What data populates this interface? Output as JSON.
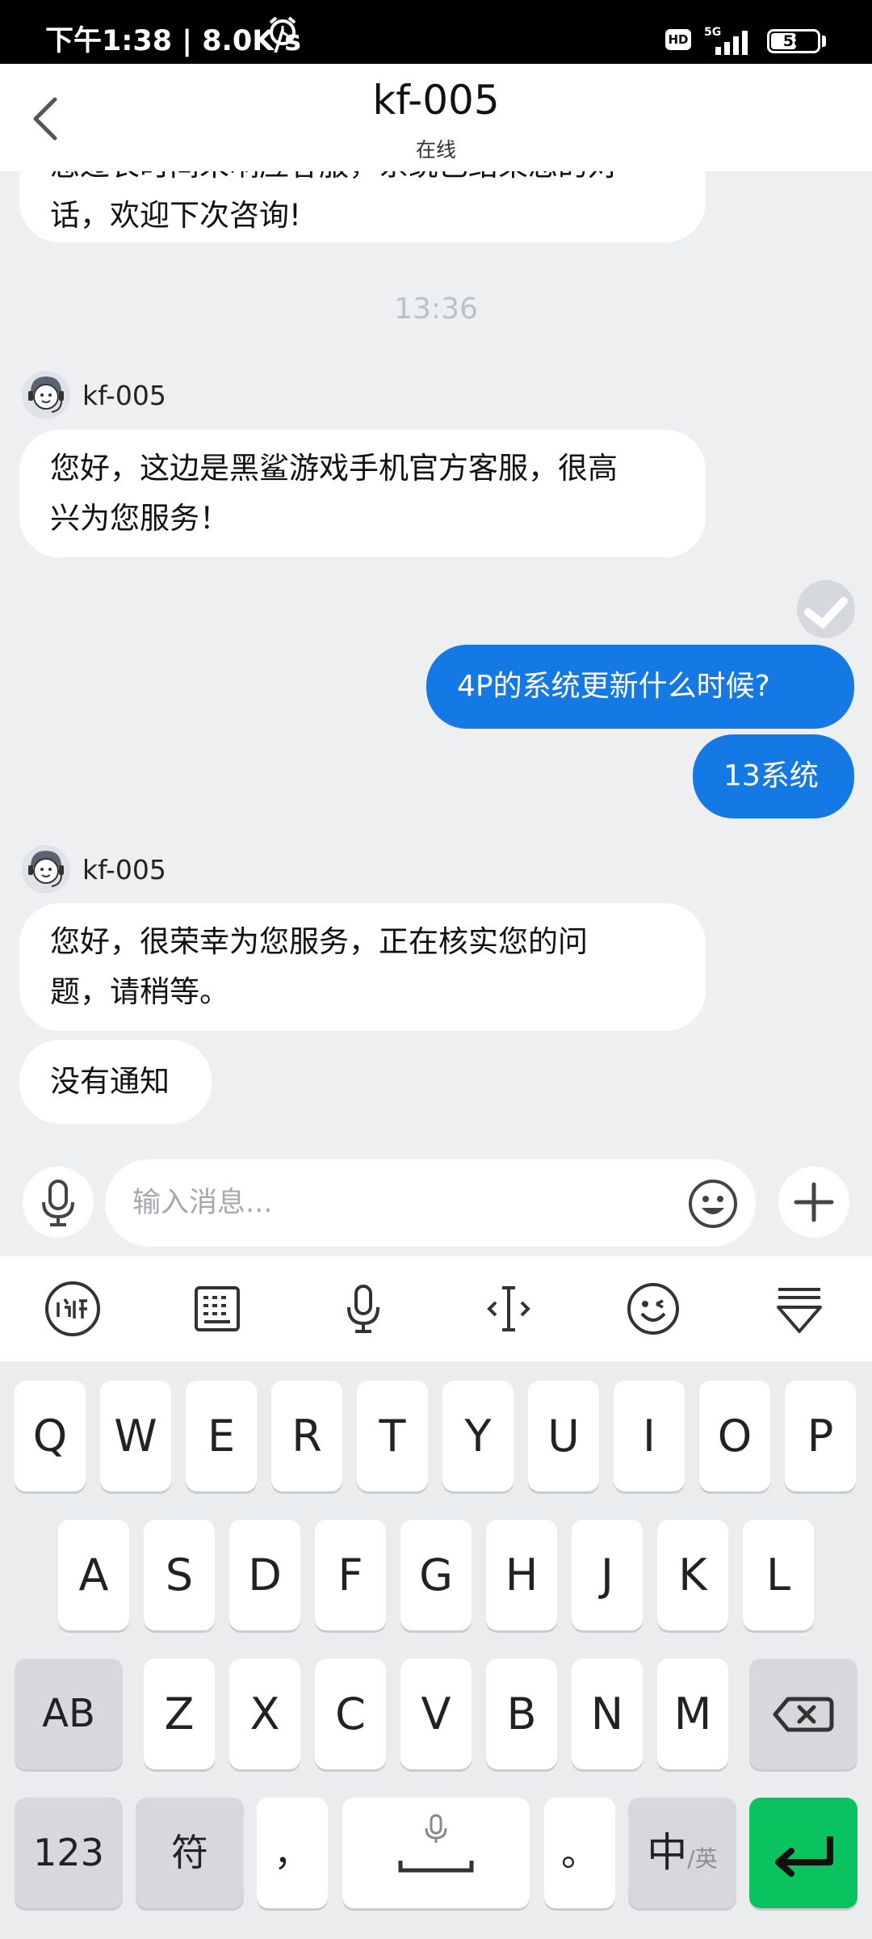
{
  "status_bar": {
    "time": "下午1:38 | 8.0K/s",
    "network_badge": "HD",
    "network_type": "5G",
    "battery": "58",
    "battery_level": 0.58
  },
  "header": {
    "title": "kf-005",
    "subtitle": "在线"
  },
  "chat": {
    "messages": [
      {
        "from": "agent",
        "text_lines": [
          "您过长时间未响应客服，系统已结束您的对",
          "话，欢迎下次咨询!"
        ]
      },
      {
        "type": "time",
        "text": "13:36"
      },
      {
        "from": "agent",
        "name": "kf-005",
        "text_lines": [
          "您好，这边是黑鲨游戏手机官方客服，很高",
          "兴为您服务！"
        ]
      },
      {
        "from": "me",
        "text_lines": [
          "4P的系统更新什么时候?"
        ]
      },
      {
        "from": "me",
        "text_lines": [
          "13系统"
        ]
      },
      {
        "from": "agent",
        "name": "kf-005",
        "text_lines": [
          "您好，很荣幸为您服务，正在核实您的问",
          "题，请稍等。"
        ]
      },
      {
        "from": "agent",
        "text_lines": [
          "没有通知"
        ]
      }
    ]
  },
  "input_bar": {
    "placeholder": "输入消息..."
  },
  "ime_toolbar": {
    "icons": [
      "ifly-logo-icon",
      "keyboard-icon",
      "microphone-icon",
      "text-cursor-icon",
      "wink-emoji-icon",
      "collapse-keyboard-icon"
    ]
  },
  "keyboard": {
    "row1": [
      "Q",
      "W",
      "E",
      "R",
      "T",
      "Y",
      "U",
      "I",
      "O",
      "P"
    ],
    "row2": [
      "A",
      "S",
      "D",
      "F",
      "G",
      "H",
      "J",
      "K",
      "L"
    ],
    "row3": [
      "AB",
      "Z",
      "X",
      "C",
      "V",
      "B",
      "N",
      "M"
    ],
    "row4": {
      "num": "123",
      "symbol": "符",
      "comma": "，",
      "period": "。",
      "lang_main": "中",
      "lang_sub": "/英"
    },
    "colors": {
      "enter": "#0ac35f",
      "accent_blue": "#1479e4"
    }
  }
}
